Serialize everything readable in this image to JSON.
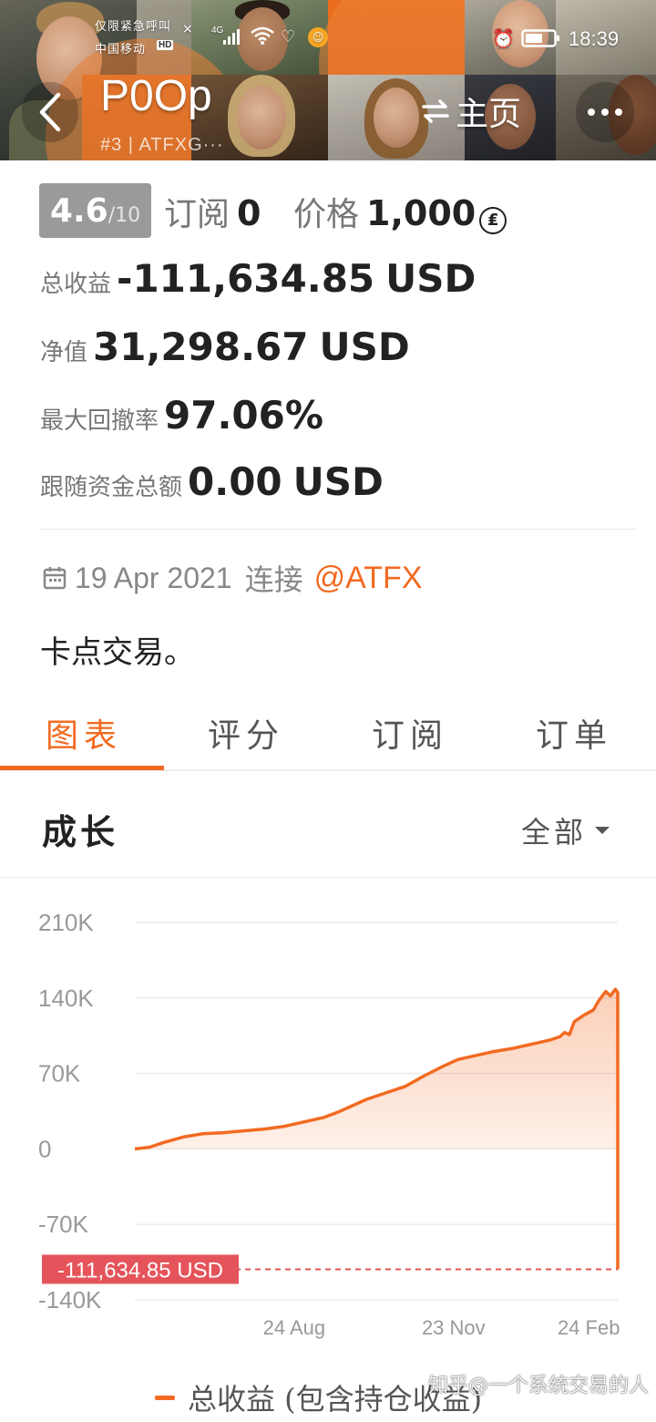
{
  "status_bar": {
    "notice": "仅限紧急呼叫",
    "carrier": "中国移动",
    "hd": "HD",
    "network": "4G",
    "time": "18:39"
  },
  "header": {
    "trader_name": "P0Op",
    "trader_id": "#3 | ATFXG···",
    "home_link": "主页",
    "icons": {
      "back": "back-chevron-icon",
      "swap": "swap-icon",
      "more": "more-dots-icon"
    }
  },
  "stats": {
    "rating": "4.6",
    "rating_max": "/10",
    "subscribers_label": "订阅",
    "subscribers_value": "0",
    "price_label": "价格",
    "price_value": "1,000",
    "price_currency_symbol": "₤",
    "total_profit_label": "总收益",
    "total_profit_main": "-111,634.",
    "total_profit_cents": "85",
    "total_profit_unit": "USD",
    "equity_label": "净值",
    "equity_main": "31,298.",
    "equity_cents": "67",
    "equity_unit": "USD",
    "max_drawdown_label": "最大回撤率",
    "max_drawdown_value": "97.06%",
    "follow_funds_label": "跟随资金总额",
    "follow_funds_main": "0.",
    "follow_funds_cents": "00",
    "follow_funds_unit": "USD"
  },
  "connection": {
    "date": "19 Apr 2021",
    "label": "连接",
    "broker": "@ATFX"
  },
  "description": "卡点交易。",
  "tabs": [
    {
      "label": "图表",
      "active": true
    },
    {
      "label": "评分",
      "active": false
    },
    {
      "label": "订阅",
      "active": false
    },
    {
      "label": "订单",
      "active": false
    }
  ],
  "growth": {
    "title": "成长",
    "range": "全部"
  },
  "chart_data": {
    "type": "area",
    "y_ticks": [
      "210K",
      "140K",
      "70K",
      "0",
      "-70K",
      "-140K"
    ],
    "ylim": [
      -140000,
      210000
    ],
    "x_ticks": [
      "24 Aug",
      "23 Nov",
      "24 Feb"
    ],
    "series": [
      {
        "name": "总收益 (包含持仓收益)",
        "color": "#f26a21",
        "points": [
          [
            0,
            0
          ],
          [
            0.03,
            1500
          ],
          [
            0.06,
            6000
          ],
          [
            0.1,
            11000
          ],
          [
            0.14,
            14000
          ],
          [
            0.18,
            15000
          ],
          [
            0.22,
            16500
          ],
          [
            0.27,
            18500
          ],
          [
            0.31,
            21000
          ],
          [
            0.35,
            25000
          ],
          [
            0.39,
            29000
          ],
          [
            0.42,
            34000
          ],
          [
            0.45,
            40000
          ],
          [
            0.48,
            46000
          ],
          [
            0.52,
            52000
          ],
          [
            0.56,
            58000
          ],
          [
            0.6,
            68000
          ],
          [
            0.64,
            77000
          ],
          [
            0.67,
            83000
          ],
          [
            0.7,
            86000
          ],
          [
            0.74,
            90000
          ],
          [
            0.78,
            93000
          ],
          [
            0.82,
            97000
          ],
          [
            0.86,
            101000
          ],
          [
            0.88,
            104000
          ],
          [
            0.89,
            108000
          ],
          [
            0.9,
            106000
          ],
          [
            0.91,
            118000
          ],
          [
            0.93,
            124000
          ],
          [
            0.95,
            129000
          ],
          [
            0.96,
            137000
          ],
          [
            0.975,
            146000
          ],
          [
            0.985,
            142000
          ],
          [
            0.995,
            148000
          ],
          [
            1.0,
            145000
          ],
          [
            1.0,
            -111634.85
          ]
        ]
      }
    ],
    "current_value": -111634.85,
    "current_label": "-111,634.85 USD"
  },
  "legend_label": "总收益 (包含持仓收益)",
  "watermark": "知乎@一个系统交易的人"
}
